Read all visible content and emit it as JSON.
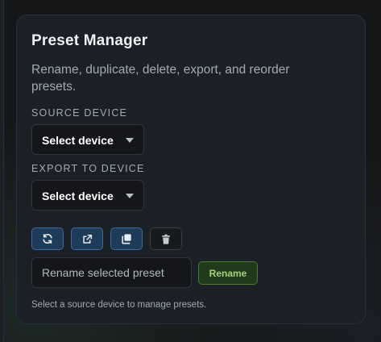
{
  "panel": {
    "title": "Preset Manager",
    "description": "Rename, duplicate, delete, export, and reorder presets."
  },
  "source": {
    "label": "SOURCE DEVICE",
    "selected": "Select device"
  },
  "export": {
    "label": "EXPORT TO DEVICE",
    "selected": "Select device"
  },
  "actions": [
    {
      "name": "refresh-icon",
      "style": "blue"
    },
    {
      "name": "export-icon",
      "style": "blue"
    },
    {
      "name": "duplicate-icon",
      "style": "blue"
    },
    {
      "name": "trash-icon",
      "style": "dark"
    }
  ],
  "rename": {
    "placeholder": "Rename selected preset",
    "value": "",
    "button_label": "Rename"
  },
  "status": "Select a source device to manage presets.",
  "colors": {
    "accent_blue": "#3b6a9c",
    "accent_green": "#9fd47a",
    "panel_bg": "#1b1f26"
  }
}
